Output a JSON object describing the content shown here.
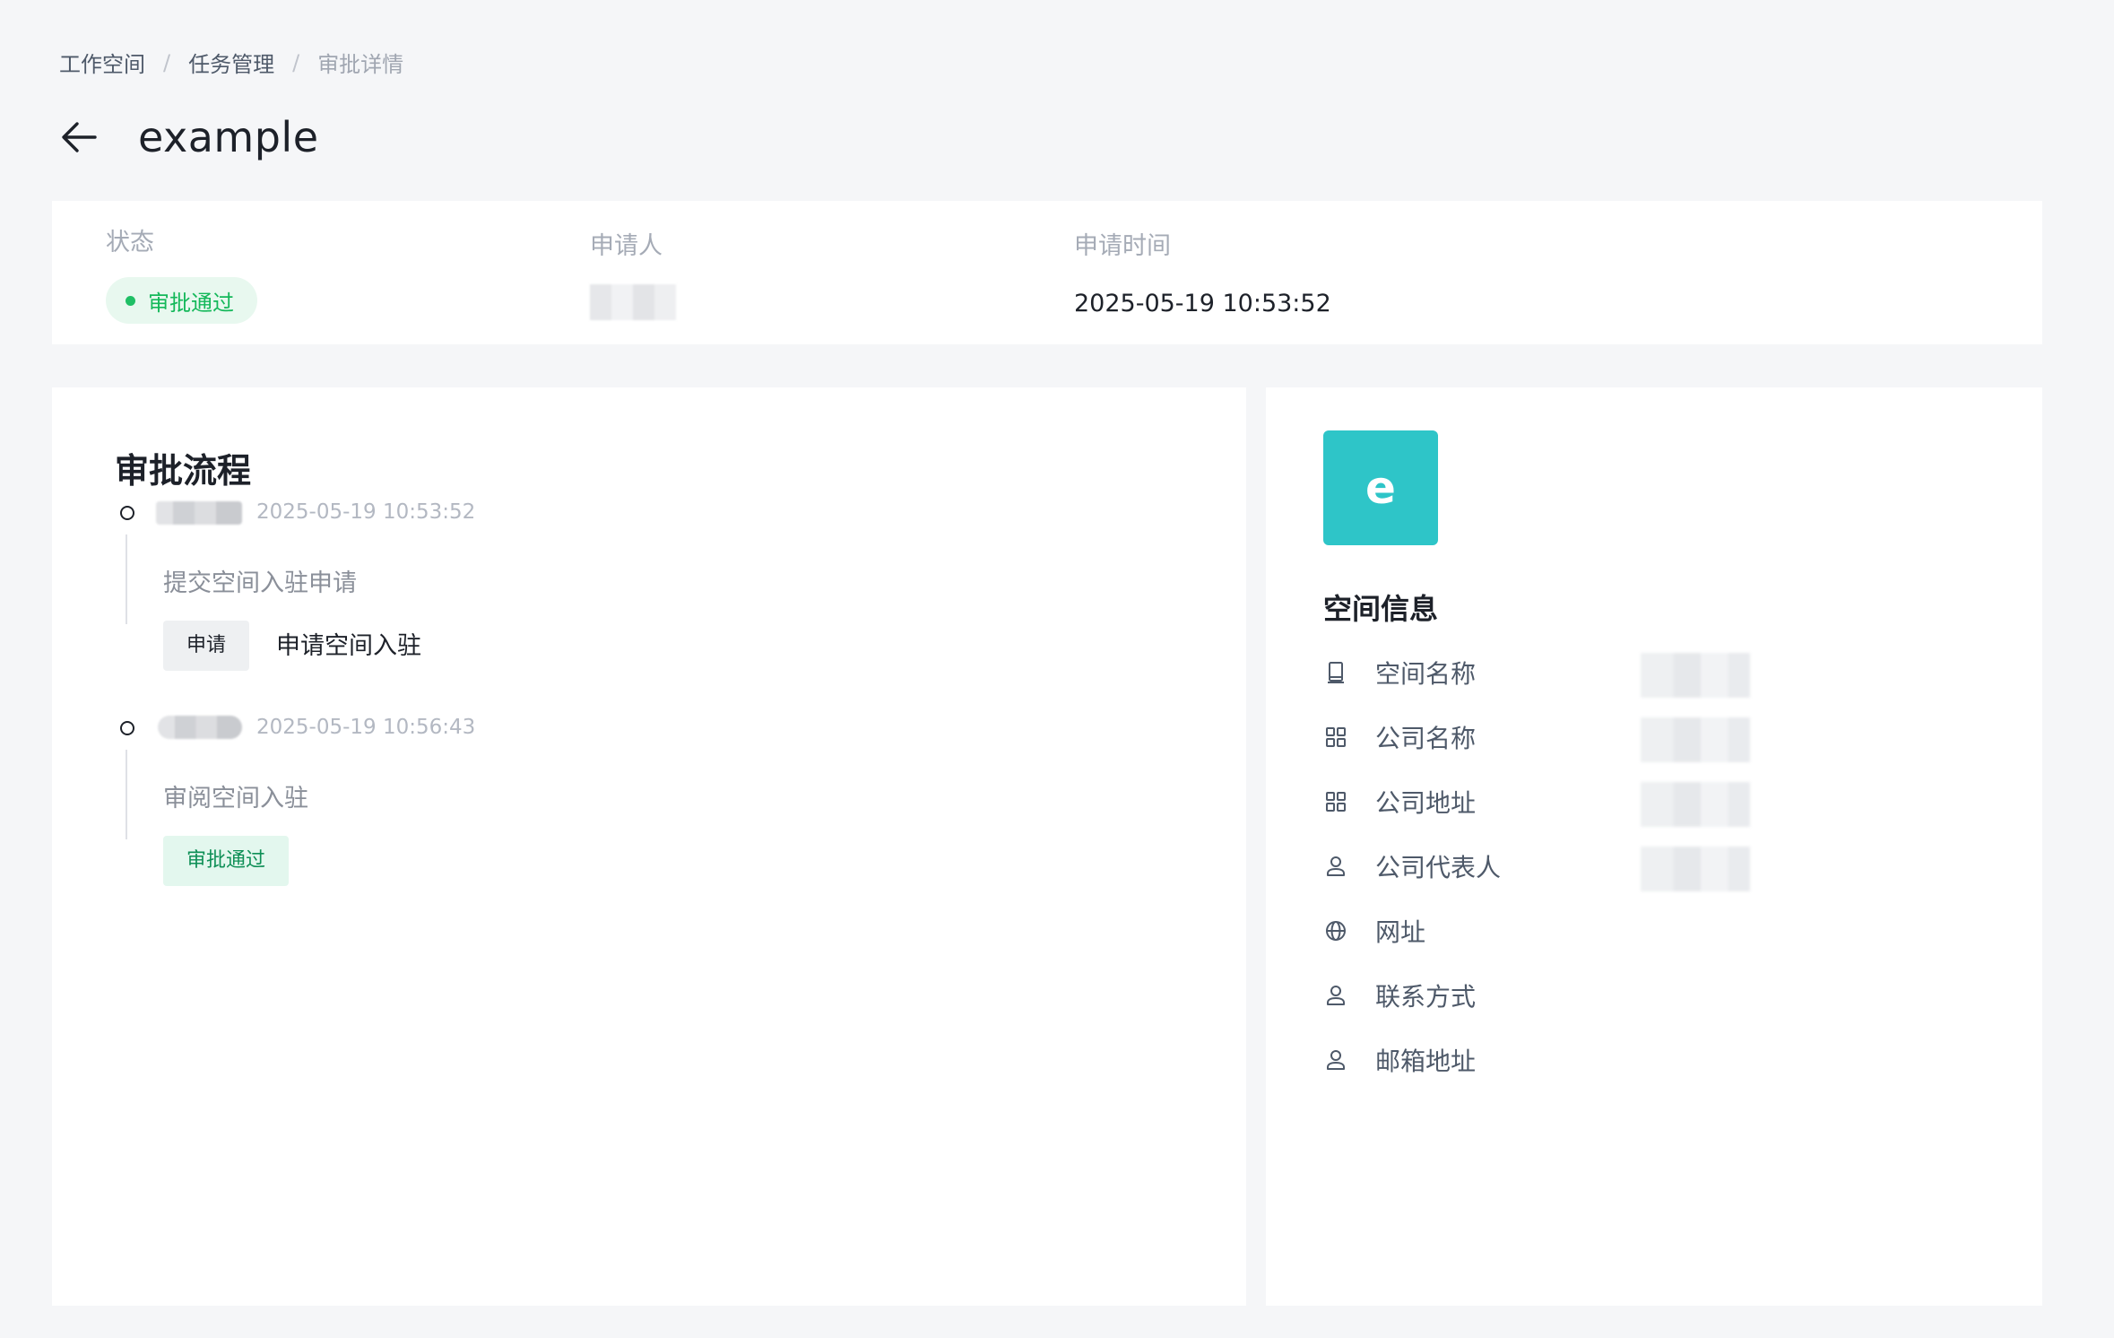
{
  "breadcrumb": [
    "工作空间",
    "任务管理",
    "审批详情"
  ],
  "breadcrumb_sep": "/",
  "page": {
    "title": "example"
  },
  "summary": {
    "status_label": "状态",
    "status_value": "审批通过",
    "applicant_label": "申请人",
    "time_label": "申请时间",
    "time_value": "2025-05-19 10:53:52"
  },
  "flow": {
    "title": "审批流程",
    "nodes": [
      {
        "time": "2025-05-19 10:53:52",
        "desc": "提交空间入驻申请",
        "tag": "申请",
        "tag_text": "申请空间入驻"
      },
      {
        "time": "2025-05-19 10:56:43",
        "desc": "审阅空间入驻",
        "tag": "审批通过"
      }
    ]
  },
  "space": {
    "avatar_letter": "e",
    "title": "空间信息",
    "rows": [
      {
        "label": "空间名称",
        "icon": "device-icon"
      },
      {
        "label": "公司名称",
        "icon": "grid-icon"
      },
      {
        "label": "公司地址",
        "icon": "grid-icon"
      },
      {
        "label": "公司代表人",
        "icon": "user-icon"
      },
      {
        "label": "网址",
        "icon": "globe-icon"
      },
      {
        "label": "联系方式",
        "icon": "user-icon"
      },
      {
        "label": "邮箱地址",
        "icon": "user-icon"
      }
    ]
  },
  "colors": {
    "accent": "#2ec5c8",
    "success": "#14b85a"
  }
}
